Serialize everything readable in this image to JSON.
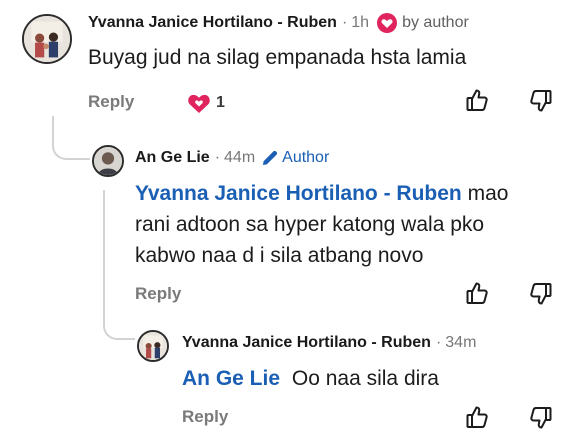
{
  "comments": [
    {
      "author": "Yvanna Janice Hortilano - Ruben",
      "separator": "·",
      "time": "1h",
      "badge": "by author",
      "text": "Buyag jud na silag empanada hsta lamia",
      "reply_label": "Reply",
      "reaction_count": "1"
    },
    {
      "author": "An Ge Lie",
      "separator": "·",
      "time": "44m",
      "badge": "Author",
      "mention": "Yvanna Janice Hortilano - Ruben",
      "text_first": " mao",
      "text_lines": [
        "rani adtoon sa hyper katong wala pko",
        "kabwo naa d i sila atbang novo"
      ],
      "reply_label": "Reply"
    },
    {
      "author": "Yvanna Janice Hortilano - Ruben",
      "separator": "·",
      "time": "34m",
      "mention": "An Ge Lie",
      "text": "Oo naa sila dira",
      "reply_label": "Reply"
    }
  ],
  "colors": {
    "mention": "#1a5fb4",
    "heart": "#e0245e",
    "author_badge": "#1a5fb4"
  },
  "icons": [
    "like-icon",
    "dislike-icon",
    "heart-icon",
    "pencil-icon"
  ]
}
